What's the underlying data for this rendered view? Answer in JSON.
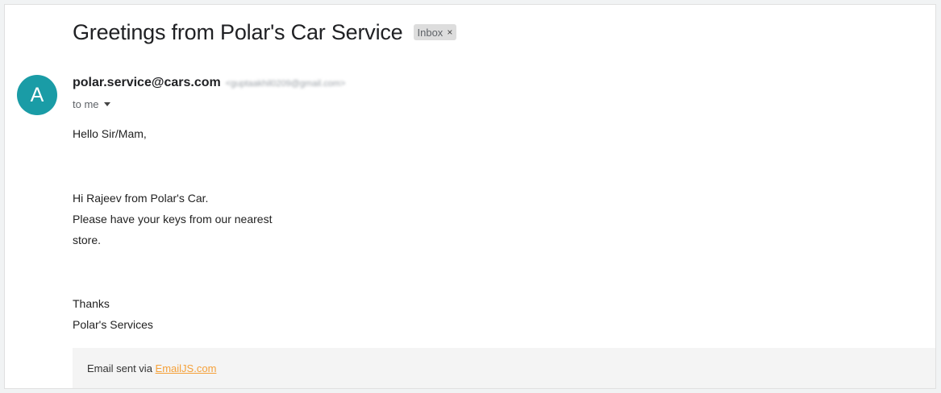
{
  "email": {
    "subject": "Greetings from Polar's Car Service",
    "label": "Inbox",
    "label_close": "×",
    "avatar_letter": "A",
    "avatar_color": "#1a9ca6",
    "sender_name": "polar.service@cars.com",
    "sender_email": "<guptaakhil0209@gmail.com>",
    "recipient": "to me",
    "body": {
      "greeting": "Hello Sir/Mam,",
      "line1": "Hi Rajeev from Polar's Car.",
      "line2": "Please have your keys from our nearest",
      "line3": "store.",
      "thanks": "Thanks",
      "signature": "Polar's Services"
    },
    "footer": {
      "prefix": "Email sent via ",
      "link_text": "EmailJS.com",
      "link_color": "#f5a13a"
    }
  }
}
